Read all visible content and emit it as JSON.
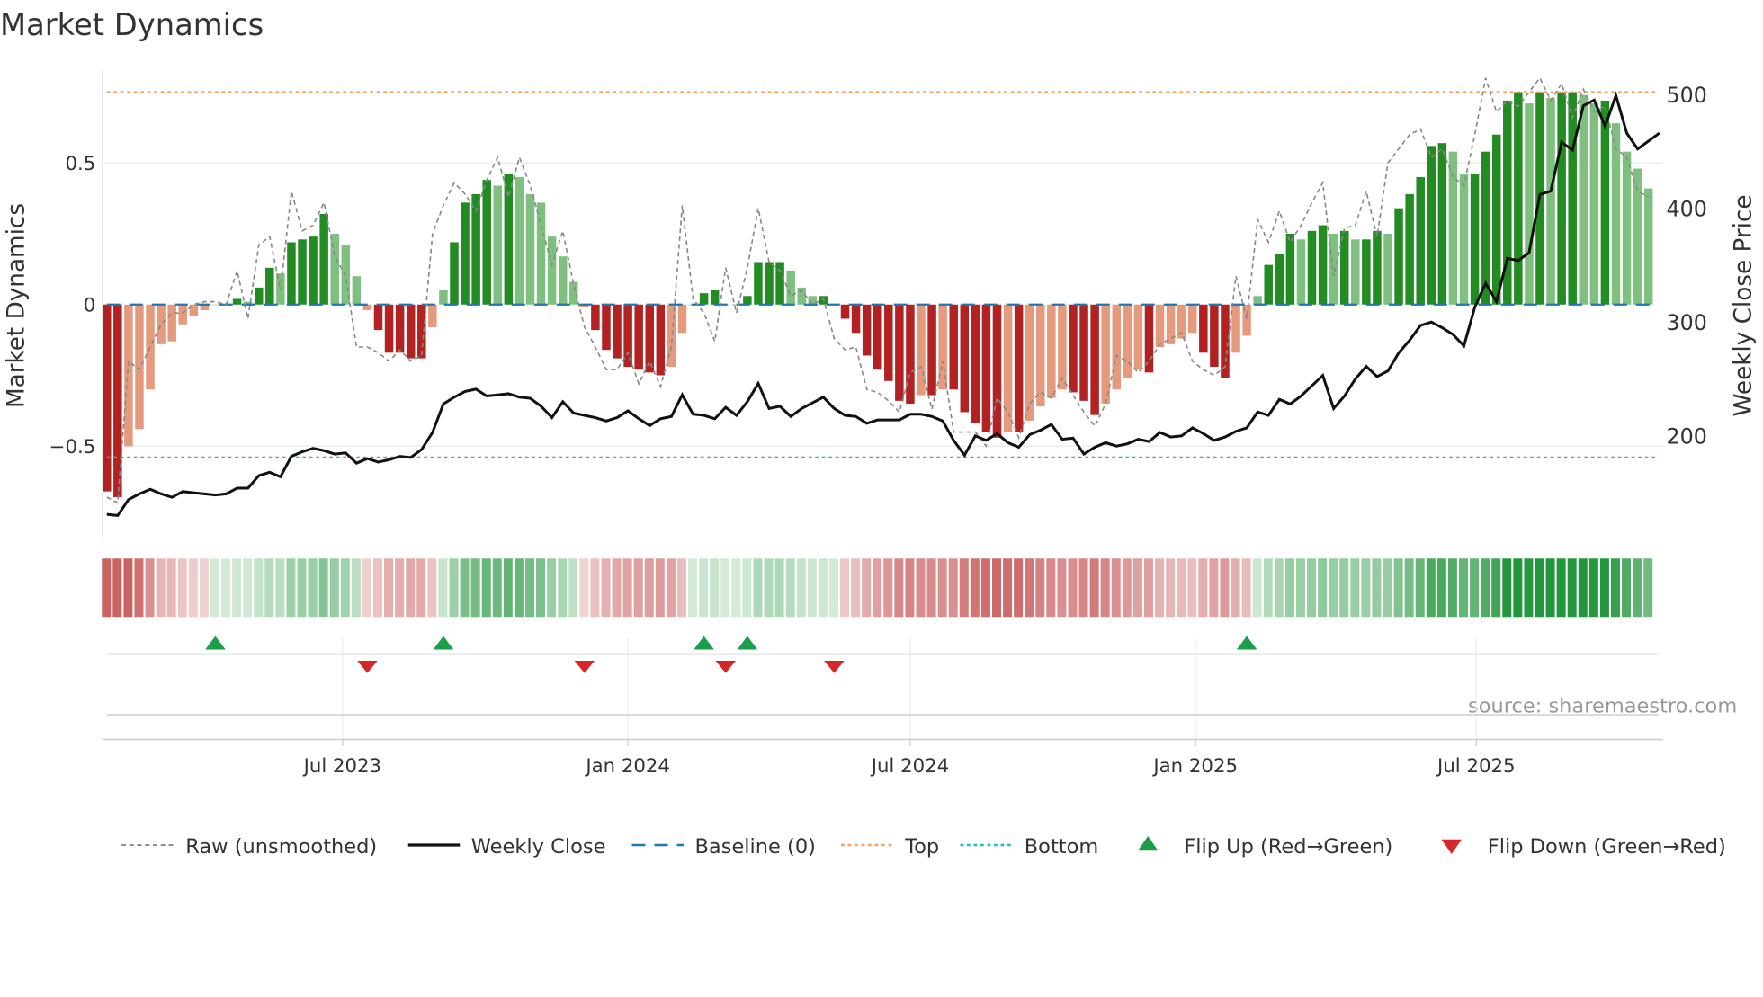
{
  "chart_data": {
    "type": "bar",
    "title": "Market Dynamics",
    "ylabel": "Market Dynamics",
    "y2label": "Weekly Close Price",
    "ylim": [
      -0.82,
      0.82
    ],
    "y2lim": [
      118,
      521
    ],
    "yticks": [
      {
        "v": 0.5,
        "label": "0.5"
      },
      {
        "v": 0,
        "label": "0"
      },
      {
        "v": -0.5,
        "label": "−0.5"
      }
    ],
    "y2ticks": [
      {
        "v": 500,
        "label": "500"
      },
      {
        "v": 400,
        "label": "400"
      },
      {
        "v": 300,
        "label": "300"
      },
      {
        "v": 200,
        "label": "200"
      }
    ],
    "first_week": "2023-01-30",
    "xticks": [
      {
        "date": "2023-07-01",
        "label": "Jul 2023"
      },
      {
        "date": "2024-01-01",
        "label": "Jan 2024"
      },
      {
        "date": "2024-07-01",
        "label": "Jul 2024"
      },
      {
        "date": "2025-01-01",
        "label": "Jan 2025"
      },
      {
        "date": "2025-07-01",
        "label": "Jul 2025"
      }
    ],
    "top_level": 0.75,
    "bottom_level": -0.54,
    "baseline": 0,
    "colors": {
      "dark_red": "#b22222",
      "light_red": "#e59a7e",
      "dark_green": "#228b22",
      "light_green": "#7fbf7f",
      "top": "#f4a261",
      "bottom": "#17becf",
      "baseline": "#1f77b4",
      "flip_up": "#1a9e4a",
      "flip_down": "#d62728"
    },
    "series": [
      {
        "name": "Market Dynamics (smoothed)",
        "values": [
          -0.66,
          -0.68,
          -0.5,
          -0.44,
          -0.3,
          -0.14,
          -0.13,
          -0.07,
          -0.04,
          -0.02,
          0,
          0,
          0.02,
          0.01,
          0.06,
          0.13,
          0.11,
          0.22,
          0.23,
          0.24,
          0.32,
          0.25,
          0.21,
          0.1,
          -0.02,
          -0.09,
          -0.17,
          -0.17,
          -0.19,
          -0.19,
          -0.08,
          0.05,
          0.22,
          0.36,
          0.39,
          0.44,
          0.42,
          0.46,
          0.45,
          0.39,
          0.36,
          0.24,
          0.17,
          0.08,
          -0.01,
          -0.09,
          -0.16,
          -0.19,
          -0.22,
          -0.23,
          -0.24,
          -0.25,
          -0.22,
          -0.1,
          0,
          0.04,
          0.05,
          0,
          0,
          0.03,
          0.15,
          0.15,
          0.15,
          0.12,
          0.06,
          0.03,
          0.03,
          0,
          -0.05,
          -0.1,
          -0.18,
          -0.23,
          -0.27,
          -0.34,
          -0.35,
          -0.32,
          -0.32,
          -0.3,
          -0.3,
          -0.38,
          -0.42,
          -0.45,
          -0.47,
          -0.45,
          -0.45,
          -0.41,
          -0.36,
          -0.33,
          -0.3,
          -0.31,
          -0.34,
          -0.39,
          -0.35,
          -0.3,
          -0.26,
          -0.23,
          -0.24,
          -0.15,
          -0.14,
          -0.12,
          -0.1,
          -0.17,
          -0.22,
          -0.26,
          -0.17,
          -0.11,
          0.03,
          0.14,
          0.18,
          0.25,
          0.23,
          0.26,
          0.28,
          0.25,
          0.26,
          0.23,
          0.23,
          0.26,
          0.25,
          0.34,
          0.39,
          0.45,
          0.56,
          0.57,
          0.54,
          0.46,
          0.46,
          0.54,
          0.6,
          0.72,
          0.75,
          0.71,
          0.75,
          0.73,
          0.75,
          0.75,
          0.74,
          0.71,
          0.72,
          0.64,
          0.54,
          0.48,
          0.41
        ]
      },
      {
        "name": "Raw (unsmoothed)",
        "values": [
          -0.68,
          -0.7,
          -0.2,
          -0.23,
          -0.15,
          -0.07,
          -0.03,
          -0.03,
          0,
          0.01,
          0.01,
          0,
          0.12,
          -0.05,
          0.21,
          0.24,
          0.05,
          0.4,
          0.26,
          0.28,
          0.36,
          0.17,
          0.1,
          -0.15,
          -0.15,
          -0.17,
          -0.2,
          -0.16,
          -0.2,
          -0.18,
          0.25,
          0.35,
          0.43,
          0.39,
          0.33,
          0.44,
          0.52,
          0.38,
          0.52,
          0.42,
          0.28,
          0.14,
          0.26,
          0.07,
          -0.08,
          -0.15,
          -0.23,
          -0.23,
          -0.17,
          -0.28,
          -0.2,
          -0.29,
          -0.15,
          0.35,
          0.02,
          -0.03,
          -0.13,
          0.13,
          -0.03,
          0.13,
          0.34,
          0.15,
          0.12,
          0.03,
          0.05,
          0,
          0.02,
          -0.12,
          -0.16,
          -0.15,
          -0.3,
          -0.31,
          -0.34,
          -0.38,
          -0.24,
          -0.22,
          -0.37,
          -0.2,
          -0.45,
          -0.45,
          -0.45,
          -0.5,
          -0.33,
          -0.38,
          -0.47,
          -0.35,
          -0.31,
          -0.33,
          -0.26,
          -0.32,
          -0.38,
          -0.43,
          -0.35,
          -0.18,
          -0.2,
          -0.24,
          -0.2,
          -0.14,
          -0.12,
          -0.1,
          -0.2,
          -0.23,
          -0.25,
          -0.22,
          0.1,
          -0.05,
          0.3,
          0.22,
          0.33,
          0.22,
          0.28,
          0.36,
          0.43,
          0.1,
          0.27,
          0.28,
          0.4,
          0.24,
          0.5,
          0.55,
          0.6,
          0.62,
          0.52,
          0.55,
          0.45,
          0.42,
          0.6,
          0.8,
          0.68,
          0.72,
          0.7,
          0.75,
          0.8,
          0.72,
          0.78,
          0.66,
          0.76,
          0.68,
          0.7,
          0.55,
          0.52,
          0.4,
          0.38
        ]
      },
      {
        "name": "Weekly Close",
        "axis": "right",
        "values": [
          131,
          130,
          144,
          149,
          153,
          149,
          146,
          151,
          150,
          149,
          148,
          149,
          154,
          154,
          165,
          168,
          164,
          182,
          186,
          189,
          187,
          184,
          185,
          176,
          180,
          177,
          179,
          182,
          181,
          188,
          203,
          228,
          234,
          239,
          241,
          235,
          236,
          237,
          234,
          233,
          226,
          216,
          230,
          220,
          218,
          216,
          213,
          216,
          222,
          215,
          209,
          215,
          217,
          236,
          219,
          218,
          215,
          225,
          218,
          230,
          246,
          224,
          226,
          217,
          224,
          229,
          234,
          224,
          218,
          217,
          211,
          214,
          214,
          214,
          219,
          219,
          217,
          213,
          196,
          183,
          200,
          196,
          202,
          194,
          190,
          201,
          205,
          210,
          197,
          198,
          184,
          190,
          194,
          191,
          193,
          197,
          195,
          203,
          199,
          200,
          207,
          202,
          196,
          199,
          204,
          207,
          221,
          218,
          232,
          228,
          235,
          244,
          253,
          224,
          235,
          250,
          261,
          252,
          257,
          273,
          284,
          297,
          300,
          295,
          289,
          279,
          313,
          334,
          318,
          356,
          354,
          361,
          412,
          415,
          458,
          451,
          490,
          495,
          472,
          499,
          466,
          452,
          459,
          466
        ]
      }
    ],
    "flip_up": [
      "2023-04-10",
      "2023-09-04",
      "2024-02-19",
      "2024-03-18",
      "2025-02-03"
    ],
    "flip_down": [
      "2023-07-17",
      "2023-12-04",
      "2024-03-04",
      "2024-05-13"
    ],
    "legend": [
      {
        "label": "Raw (unsmoothed)",
        "kind": "raw"
      },
      {
        "label": "Weekly Close",
        "kind": "close"
      },
      {
        "label": "Baseline (0)",
        "kind": "baseline"
      },
      {
        "label": "Top",
        "kind": "top"
      },
      {
        "label": "Bottom",
        "kind": "bottom"
      },
      {
        "label": "Flip Up (Red→Green)",
        "kind": "up"
      },
      {
        "label": "Flip Down (Green→Red)",
        "kind": "down"
      }
    ],
    "legend_position": "bottom",
    "source": "source: sharemaestro.com"
  }
}
